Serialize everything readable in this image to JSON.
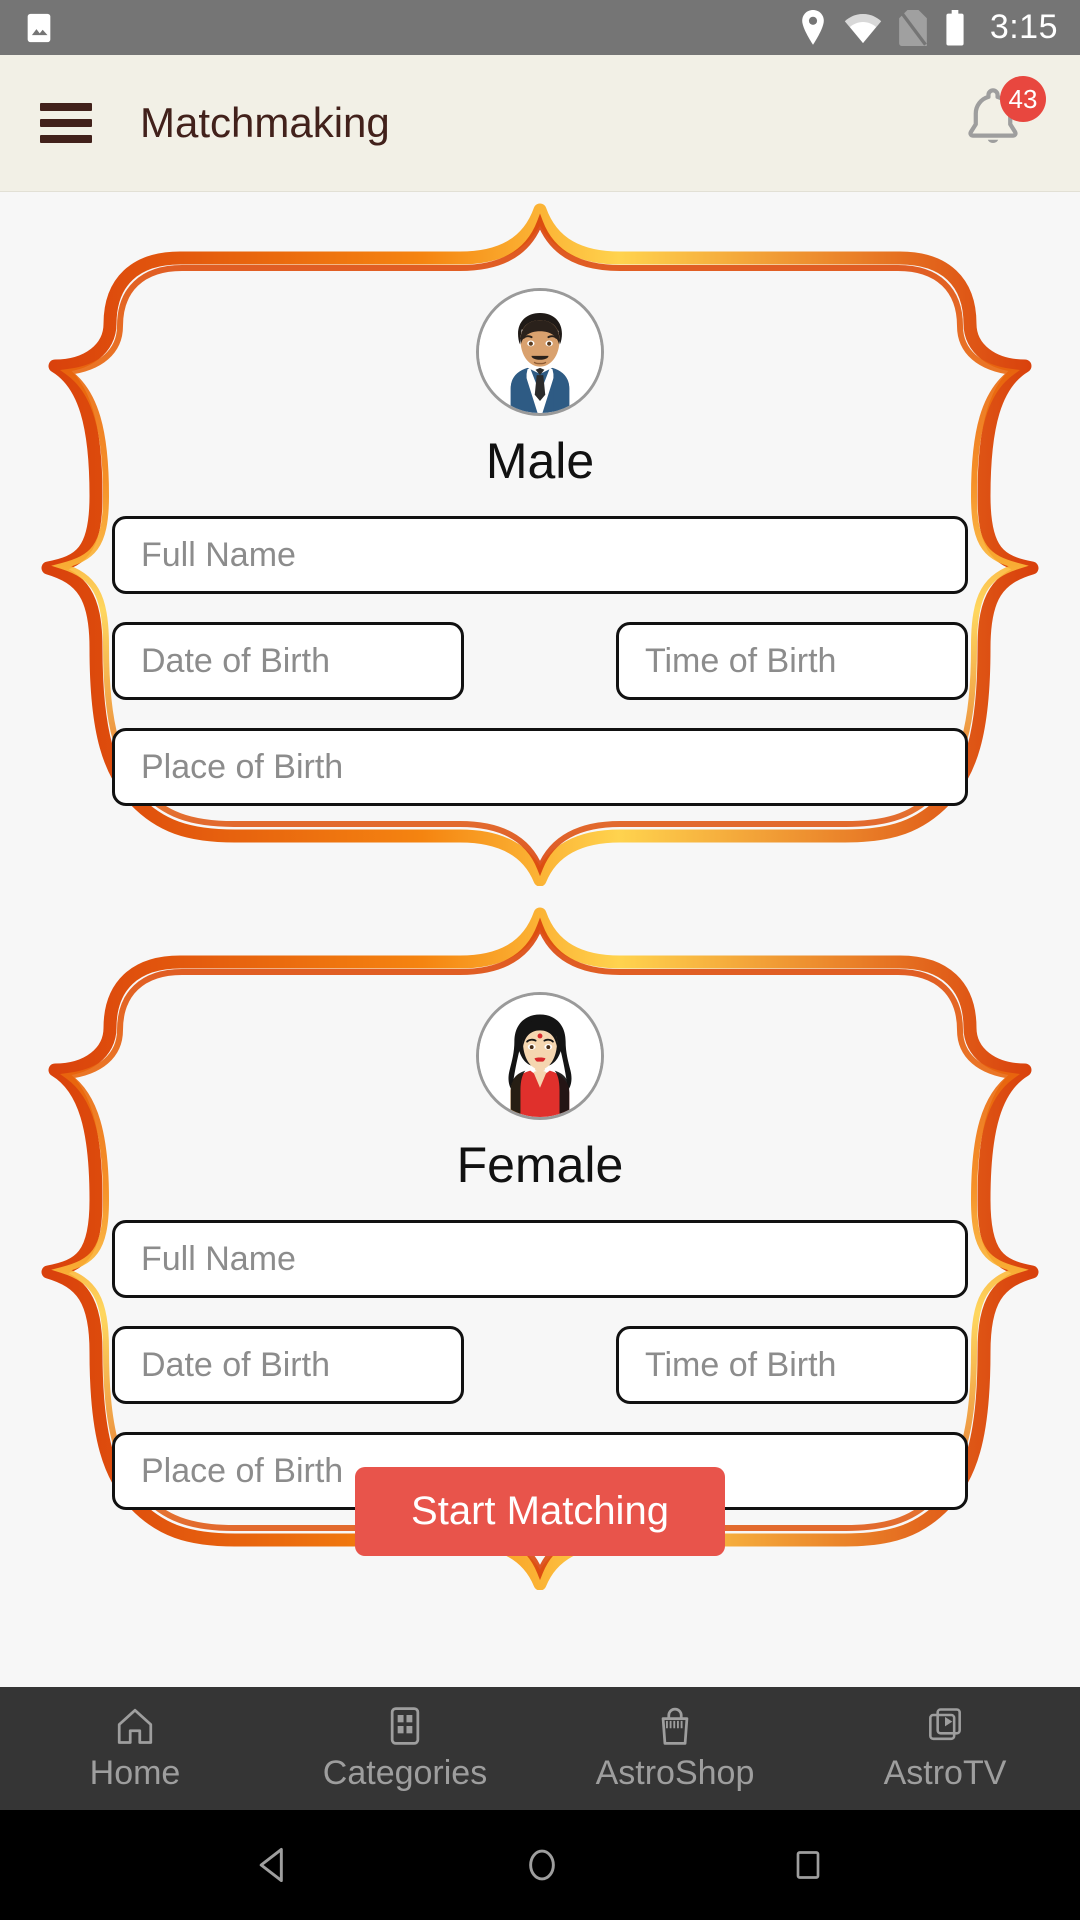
{
  "statusbar": {
    "time": "3:15",
    "icons": [
      "image-icon",
      "location-pin-icon",
      "wifi-icon",
      "no-sim-icon",
      "battery-icon"
    ]
  },
  "appbar": {
    "menu_icon": "hamburger-menu-icon",
    "title": "Matchmaking",
    "bell_icon": "notification-bell-icon",
    "badge_count": "43"
  },
  "colors": {
    "accent_red": "#E8544B",
    "badge_red": "#E8473F",
    "appbar_bg": "#F2F0E6",
    "appbar_text": "#42211B",
    "frame_orange": "#EE6B16",
    "frame_gold": "#FBC02D",
    "page_bg": "#F7F7F7",
    "nav_bg": "#353535",
    "placeholder_gray": "#8C8C8C"
  },
  "cards": [
    {
      "avatar_icon": "male-avatar-icon",
      "title": "Male",
      "full_name": {
        "placeholder": "Full Name",
        "value": ""
      },
      "date_of_birth": {
        "placeholder": "Date of Birth",
        "value": ""
      },
      "time_of_birth": {
        "placeholder": "Time of Birth",
        "value": ""
      },
      "place_of_birth": {
        "placeholder": "Place of Birth",
        "value": ""
      }
    },
    {
      "avatar_icon": "female-avatar-icon",
      "title": "Female",
      "full_name": {
        "placeholder": "Full Name",
        "value": ""
      },
      "date_of_birth": {
        "placeholder": "Date of Birth",
        "value": ""
      },
      "time_of_birth": {
        "placeholder": "Time of Birth",
        "value": ""
      },
      "place_of_birth": {
        "placeholder": "Place of Birth",
        "value": ""
      }
    }
  ],
  "cta": {
    "label": "Start Matching"
  },
  "bottomnav": {
    "items": [
      {
        "label": "Home",
        "icon": "home-icon"
      },
      {
        "label": "Categories",
        "icon": "grid-categories-icon"
      },
      {
        "label": "AstroShop",
        "icon": "shopping-bag-icon"
      },
      {
        "label": "AstroTV",
        "icon": "tv-play-icon"
      }
    ]
  },
  "androidnav": {
    "back": "back-triangle-icon",
    "home": "home-circle-icon",
    "recents": "recents-square-icon"
  }
}
